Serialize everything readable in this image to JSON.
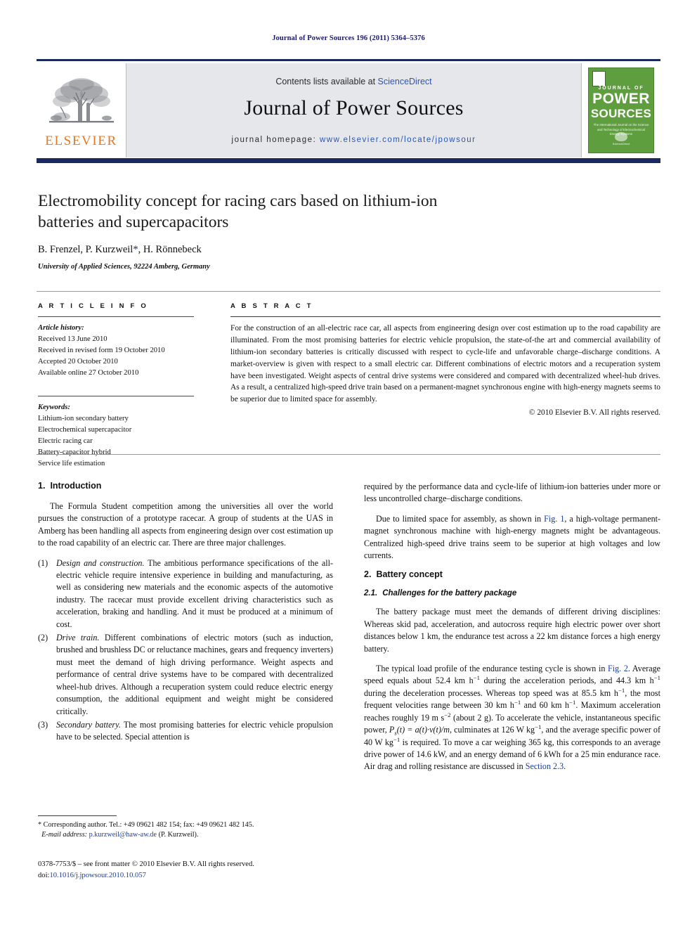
{
  "running_head": "Journal of Power Sources 196 (2011) 5364–5376",
  "masthead": {
    "publisher_name": "ELSEVIER",
    "contents_prefix": "Contents lists available at ",
    "contents_link": "ScienceDirect",
    "journal_title": "Journal of Power Sources",
    "homepage_prefix": "journal homepage: ",
    "homepage_url": "www.elsevier.com/locate/jpowsour",
    "cover": {
      "line1": "JOURNAL OF",
      "line2": "POWER",
      "line3": "SOURCES",
      "subtitle": "The International Journal on the Science and Technology of Electrochemical Energy Systems",
      "badge": "ScienceDirect"
    }
  },
  "article": {
    "title": "Electromobility concept for racing cars based on lithium-ion batteries and supercapacitors",
    "authors": "B. Frenzel, P. Kurzweil",
    "authors_suffix": ", H. Rönnebeck",
    "corresponding_marker": "*",
    "affiliation": "University of Applied Sciences, 92224 Amberg, Germany"
  },
  "info": {
    "heading": "A R T I C L E    I N F O",
    "history_label": "Article history:",
    "history": [
      "Received 13 June 2010",
      "Received in revised form 19 October 2010",
      "Accepted 20 October 2010",
      "Available online 27 October 2010"
    ],
    "keywords_label": "Keywords:",
    "keywords": [
      "Lithium-ion secondary battery",
      "Electrochemical supercapacitor",
      "Electric racing car",
      "Battery-capacitor hybrid",
      "Service life estimation"
    ]
  },
  "abstract": {
    "heading": "A B S T R A C T",
    "text": "For the construction of an all-electric race car, all aspects from engineering design over cost estimation up to the road capability are illuminated. From the most promising batteries for electric vehicle propulsion, the state-of-the art and commercial availability of lithium-ion secondary batteries is critically discussed with respect to cycle-life and unfavorable charge–discharge conditions. A market-overview is given with respect to a small electric car. Different combinations of electric motors and a recuperation system have been investigated. Weight aspects of central drive systems were considered and compared with decentralized wheel-hub drives. As a result, a centralized high-speed drive train based on a permanent-magnet synchronous engine with high-energy magnets seems to be superior due to limited space for assembly.",
    "copyright": "© 2010 Elsevier B.V. All rights reserved."
  },
  "body": {
    "intro_heading_num": "1.",
    "intro_heading": "Introduction",
    "intro_p1": "The Formula Student competition among the universities all over the world pursues the construction of a prototype racecar. A group of students at the UAS in Amberg has been handling all aspects from engineering design over cost estimation up to the road capability of an electric car. There are three major challenges.",
    "list": [
      {
        "marker": "(1)",
        "lead": "Design and construction.",
        "text": " The ambitious performance specifications of the all-electric vehicle require intensive experience in building and manufacturing, as well as considering new materials and the economic aspects of the automotive industry. The racecar must provide excellent driving characteristics such as acceleration, braking and handling. And it must be produced at a minimum of cost."
      },
      {
        "marker": "(2)",
        "lead": "Drive train.",
        "text": " Different combinations of electric motors (such as induction, brushed and brushless DC or reluctance machines, gears and frequency inverters) must meet the demand of high driving performance. Weight aspects and performance of central drive systems have to be compared with decentralized wheel-hub drives. Although a recuperation system could reduce electric energy consumption, the additional equipment and weight might be considered critically."
      },
      {
        "marker": "(3)",
        "lead": "Secondary battery.",
        "text": " The most promising batteries for electric vehicle propulsion have to be selected. Special attention is"
      }
    ],
    "right_p1": "required by the performance data and cycle-life of lithium-ion batteries under more or less uncontrolled charge–discharge conditions.",
    "right_p2_a": "Due to limited space for assembly, as shown in ",
    "right_p2_link": "Fig. 1",
    "right_p2_b": ", a high-voltage permanent-magnet synchronous machine with high-energy magnets might be advantageous. Centralized high-speed drive trains seem to be superior at high voltages and low currents.",
    "battery_heading_num": "2.",
    "battery_heading": "Battery concept",
    "challenges_heading_num": "2.1.",
    "challenges_heading": "Challenges for the battery package",
    "battery_p1": "The battery package must meet the demands of different driving disciplines: Whereas skid pad, acceleration, and autocross require high electric power over short distances below 1 km, the endurance test across a 22 km distance forces a high energy battery.",
    "battery_p2_a": "The typical load profile of the endurance testing cycle is shown in ",
    "battery_p2_link": "Fig. 2",
    "battery_p2_b": ". Average speed equals about 52.4 km h",
    "battery_p2_c": " during the acceleration periods, and 44.3 km h",
    "battery_p2_d": " during the deceleration processes. Whereas top speed was at 85.5 km h",
    "battery_p2_e": ", the most frequent velocities range between 30 km h",
    "battery_p2_f": " and 60 km h",
    "battery_p2_g": ". Maximum acceleration reaches roughly 19 m s",
    "battery_p2_h": " (about 2 g). To accelerate the vehicle, instantaneous specific power, ",
    "battery_p2_formula": "P",
    "battery_p2_formula_sub": "s",
    "battery_p2_formula_rest": "(t) = a(t)·v(t)/m",
    "battery_p2_i": ", culminates at 126 W kg",
    "battery_p2_j": ", and the average specific power of 40 W kg",
    "battery_p2_k": " is required. To move a car weighing 365 kg, this corresponds to an average drive power of 14.6 kW, and an energy demand of 6 kWh for a 25 min endurance race. Air drag and rolling resistance are discussed in ",
    "battery_p2_section_link": "Section 2.3",
    "battery_p2_end": "."
  },
  "footnotes": {
    "corresponding": "* Corresponding author. Tel.: +49 09621 482 154; fax: +49 09621 482 145.",
    "email_label": "E-mail address:",
    "email": "p.kurzweil@haw-aw.de",
    "email_suffix": " (P. Kurzweil)."
  },
  "imprint": {
    "issn_line": "0378-7753/$ – see front matter © 2010 Elsevier B.V. All rights reserved.",
    "doi_label": "doi:",
    "doi": "10.1016/j.jpowsour.2010.10.057"
  },
  "colors": {
    "masthead_rule": "#1a2a5e",
    "link_blue": "#2b56b0",
    "elsevier_orange": "#E87722",
    "cover_green": "#5f9e3f"
  }
}
